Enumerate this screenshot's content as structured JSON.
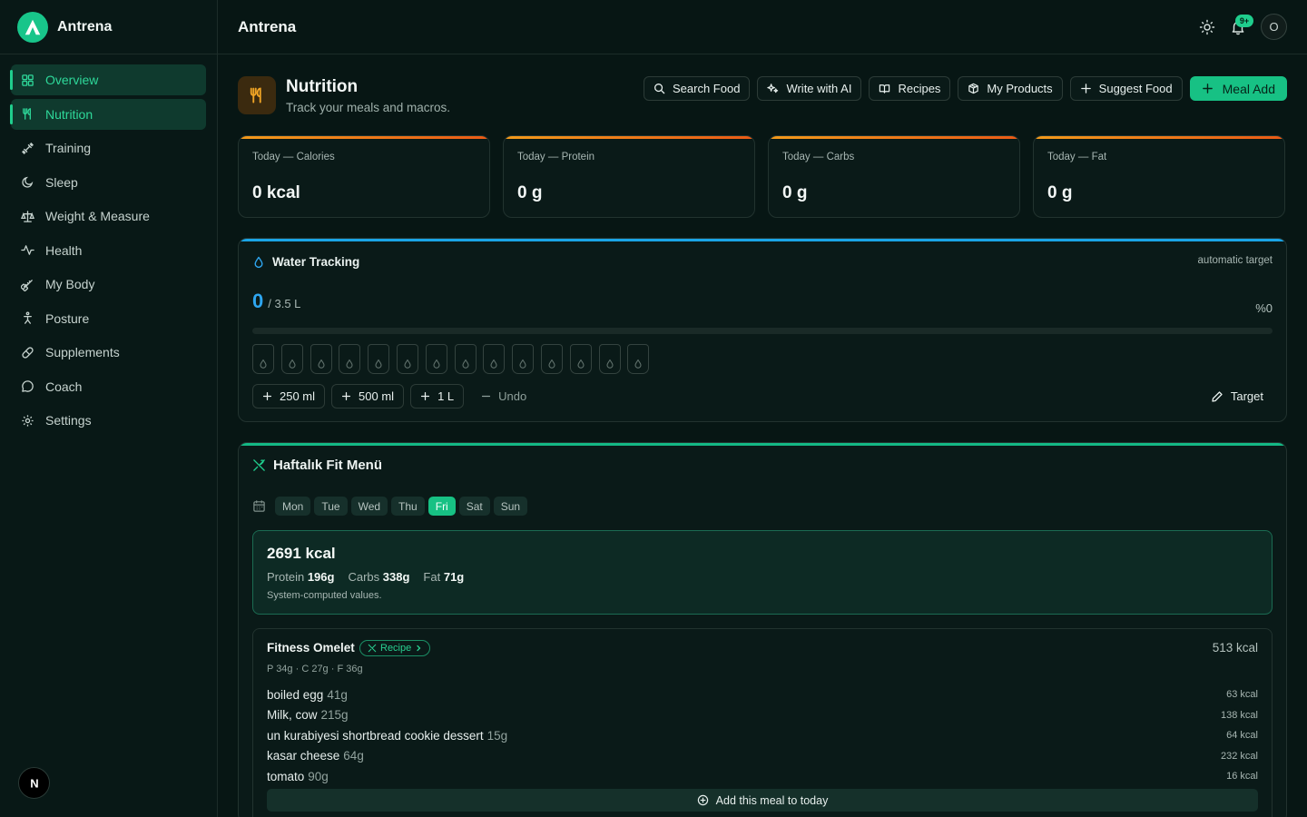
{
  "brand": {
    "name": "Antrena"
  },
  "sidebar": {
    "items": [
      {
        "label": "Overview",
        "icon": "grid-icon"
      },
      {
        "label": "Nutrition",
        "icon": "utensils-icon"
      },
      {
        "label": "Training",
        "icon": "dumbbell-icon"
      },
      {
        "label": "Sleep",
        "icon": "moon-icon"
      },
      {
        "label": "Weight & Measure",
        "icon": "scale-icon"
      },
      {
        "label": "Health",
        "icon": "activity-icon"
      },
      {
        "label": "My Body",
        "icon": "tape-icon"
      },
      {
        "label": "Posture",
        "icon": "person-icon"
      },
      {
        "label": "Supplements",
        "icon": "pill-icon"
      },
      {
        "label": "Coach",
        "icon": "chat-icon"
      },
      {
        "label": "Settings",
        "icon": "gear-icon"
      }
    ],
    "active": [
      "Overview",
      "Nutrition"
    ],
    "footer_badge": "N"
  },
  "topbar": {
    "title": "Antrena",
    "notifications": "9+",
    "avatar_initial": "O"
  },
  "page": {
    "title": "Nutrition",
    "subtitle": "Track your meals and macros.",
    "actions": {
      "search_food": "Search Food",
      "write_ai": "Write with AI",
      "recipes": "Recipes",
      "my_products": "My Products",
      "suggest_food": "Suggest Food",
      "meal_add": "Meal Add"
    }
  },
  "stats": [
    {
      "label": "Today — Calories",
      "value": "0 kcal"
    },
    {
      "label": "Today — Protein",
      "value": "0 g"
    },
    {
      "label": "Today — Carbs",
      "value": "0 g"
    },
    {
      "label": "Today — Fat",
      "value": "0 g"
    }
  ],
  "water": {
    "title": "Water Tracking",
    "auto_target": "automatic target",
    "current": "0",
    "total": "/ 3.5 L",
    "percent_label": "%0",
    "progress": 0,
    "glasses_count": 14,
    "buttons": {
      "b250": "250 ml",
      "b500": "500 ml",
      "b1l": "1 L",
      "undo": "Undo"
    },
    "target_label": "Target"
  },
  "menu": {
    "title": "Haftalık Fit Menü",
    "days": [
      "Mon",
      "Tue",
      "Wed",
      "Thu",
      "Fri",
      "Sat",
      "Sun"
    ],
    "active_day": "Fri",
    "summary": {
      "kcal": "2691 kcal",
      "protein_label": "Protein",
      "protein": "196g",
      "carbs_label": "Carbs",
      "carbs": "338g",
      "fat_label": "Fat",
      "fat": "71g",
      "note": "System-computed values."
    },
    "meal": {
      "name": "Fitness Omelet",
      "recipe_label": "Recipe",
      "kcal": "513 kcal",
      "macros": "P 34g · C 27g · F 36g",
      "foods": [
        {
          "name": "boiled egg",
          "weight": "41g",
          "kcal": "63 kcal"
        },
        {
          "name": "Milk, cow",
          "weight": "215g",
          "kcal": "138 kcal"
        },
        {
          "name": "un kurabiyesi shortbread cookie dessert",
          "weight": "15g",
          "kcal": "64 kcal"
        },
        {
          "name": "kasar cheese",
          "weight": "64g",
          "kcal": "232 kcal"
        },
        {
          "name": "tomato",
          "weight": "90g",
          "kcal": "16 kcal"
        }
      ],
      "add_label": "Add this meal to today"
    }
  },
  "colors": {
    "accent": "#17c184",
    "water": "#2ea6f0",
    "macro_gradient": "#f29a1b"
  }
}
